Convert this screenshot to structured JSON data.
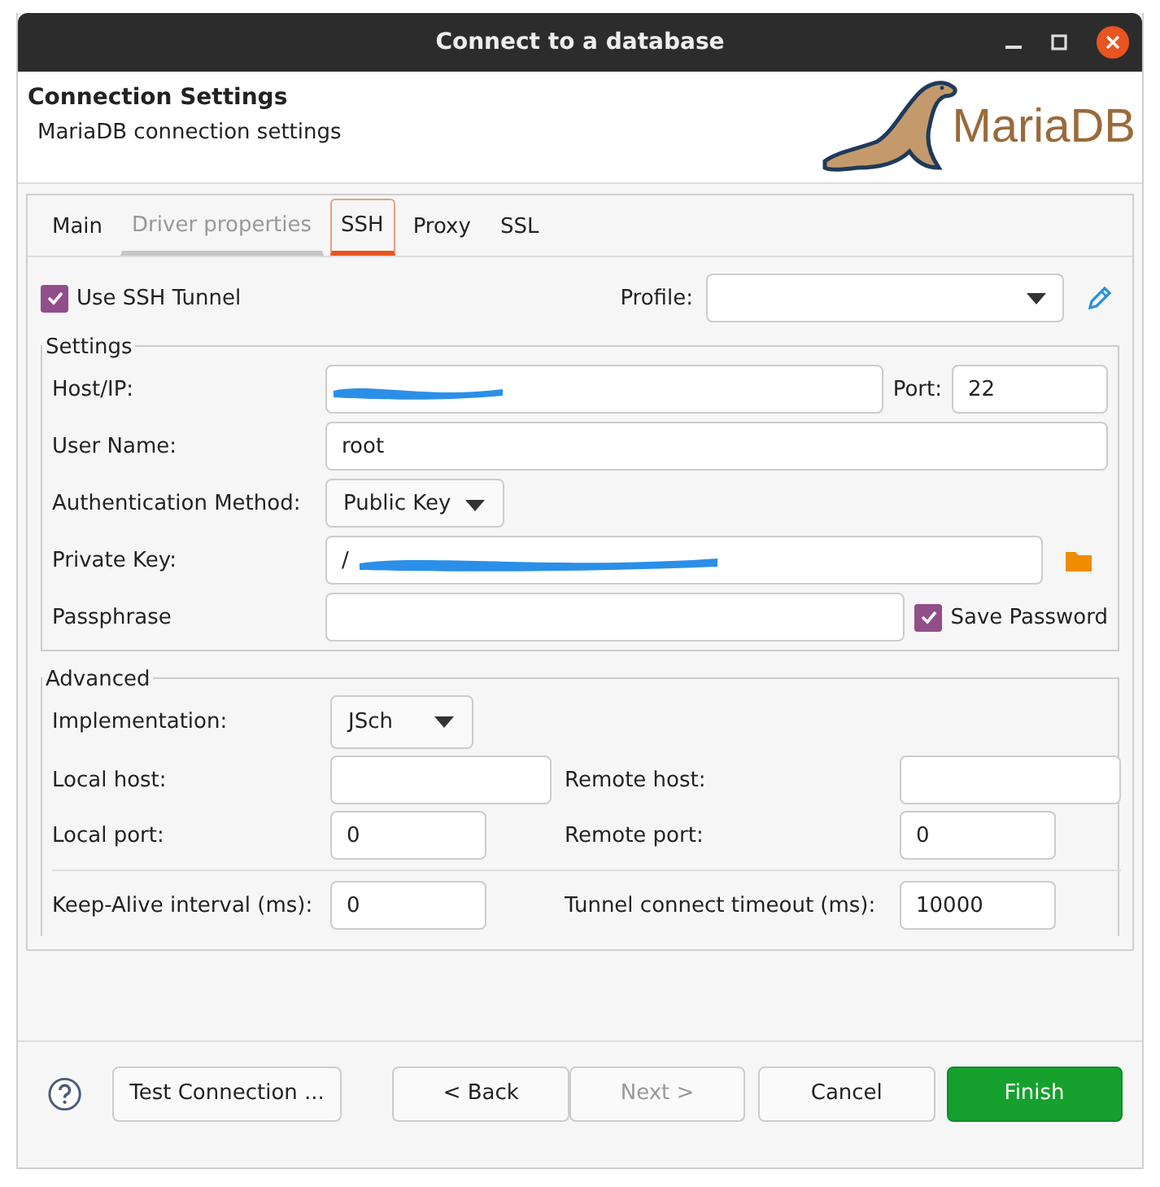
{
  "window": {
    "title": "Connect to a database"
  },
  "header": {
    "title": "Connection Settings",
    "subtitle": "MariaDB connection settings",
    "logo_text": "MariaDB"
  },
  "tabs": [
    {
      "label": "Main",
      "selected": false,
      "disabled": false
    },
    {
      "label": "Driver properties",
      "selected": false,
      "disabled": true
    },
    {
      "label": "SSH",
      "selected": true,
      "disabled": false
    },
    {
      "label": "Proxy",
      "selected": false,
      "disabled": false
    },
    {
      "label": "SSL",
      "selected": false,
      "disabled": false
    }
  ],
  "use_ssh_tunnel": {
    "label": "Use SSH Tunnel",
    "checked": true
  },
  "profile": {
    "label": "Profile:"
  },
  "settings": {
    "title": "Settings",
    "host": {
      "label": "Host/IP:",
      "redacted": true
    },
    "port": {
      "label": "Port:",
      "value": "22"
    },
    "user": {
      "label": "User Name:",
      "value": "root"
    },
    "auth": {
      "label": "Authentication Method:",
      "value": "Public Key"
    },
    "private_key": {
      "label": "Private Key:",
      "value": "/",
      "redacted": true
    },
    "passphrase": {
      "label": "Passphrase"
    },
    "save_password": {
      "label": "Save Password",
      "checked": true
    }
  },
  "advanced": {
    "title": "Advanced",
    "implementation": {
      "label": "Implementation:",
      "value": "JSch"
    },
    "local_host": {
      "label": "Local host:"
    },
    "remote_host": {
      "label": "Remote host:"
    },
    "local_port": {
      "label": "Local port:",
      "value": "0"
    },
    "remote_port": {
      "label": "Remote port:",
      "value": "0"
    },
    "keep_alive": {
      "label": "Keep-Alive interval (ms):",
      "value": "0"
    },
    "tunnel_timeout": {
      "label": "Tunnel connect timeout (ms):",
      "value": "10000"
    }
  },
  "buttons": [
    {
      "label": "Test Connection ...",
      "kind": "secondary",
      "disabled": false
    },
    {
      "label": "< Back",
      "kind": "secondary",
      "disabled": false
    },
    {
      "label": "Next >",
      "kind": "secondary",
      "disabled": true
    },
    {
      "label": "Cancel",
      "kind": "secondary",
      "disabled": false
    },
    {
      "label": "Finish",
      "kind": "primary",
      "disabled": false
    }
  ]
}
